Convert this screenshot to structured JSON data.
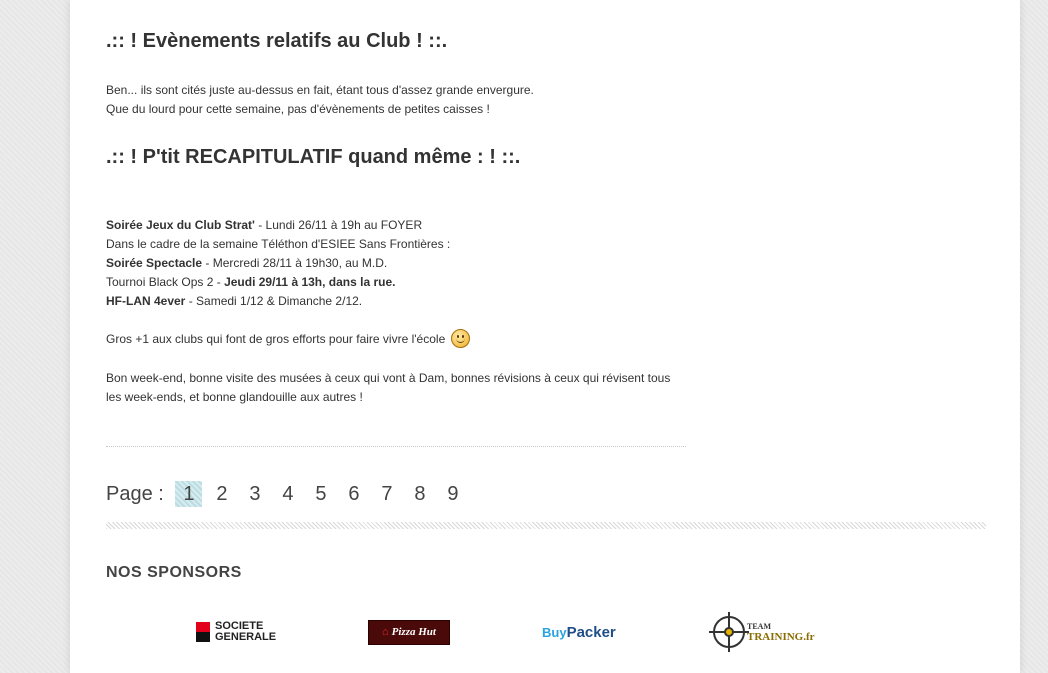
{
  "events_section": {
    "title": ".:: ! Evènements relatifs au Club ! ::.",
    "line1": "Ben... ils sont cités juste au-dessus en fait, étant tous d'assez grande envergure.",
    "line2": "Que du lourd pour cette semaine, pas d'évènements de petites caisses !"
  },
  "recap_section": {
    "title": ".:: ! P'tit RECAPITULATIF quand même : ! ::.",
    "item1_bold": "Soirée Jeux du Club Strat'",
    "item1_rest": " - Lundi 26/11 à 19h au FOYER",
    "item2": "Dans le cadre de la semaine Téléthon d'ESIEE Sans Frontières :",
    "item3_bold": "Soirée Spectacle",
    "item3_rest": " - Mercredi 28/11 à 19h30, au M.D.",
    "item4_prefix": "Tournoi Black Ops 2 - ",
    "item4_bold": "Jeudi 29/11 à 13h, dans la rue.",
    "item5_bold": "HF-LAN 4ever",
    "item5_rest": " - Samedi 1/12 & Dimanche 2/12.",
    "thanks": "Gros +1 aux clubs qui font de gros efforts pour faire vivre l'école",
    "weekend_line1": "Bon week-end, bonne visite des musées à ceux qui vont à Dam, bonnes révisions à ceux qui révisent tous",
    "weekend_line2": "les week-ends, et bonne glandouille aux autres !"
  },
  "pagination": {
    "label": "Page :",
    "pages": [
      "1",
      "2",
      "3",
      "4",
      "5",
      "6",
      "7",
      "8",
      "9"
    ],
    "current": "1"
  },
  "sponsors": {
    "title": "NOS SPONSORS",
    "societe_generale_line1": "SOCIETE",
    "societe_generale_line2": "GENERALE",
    "pizza_hut": "Pizza Hut",
    "buypacker_1": "Buy",
    "buypacker_2": "Packer",
    "team_training_1": "TEAM",
    "team_training_2": "TRAINING.fr"
  },
  "colors": {
    "page_bg": "#ffffff",
    "body_bg": "#ececec",
    "active_page": "#b9dde2",
    "sg_red": "#e2001a",
    "buypacker_blue": "#2aa3e0"
  }
}
